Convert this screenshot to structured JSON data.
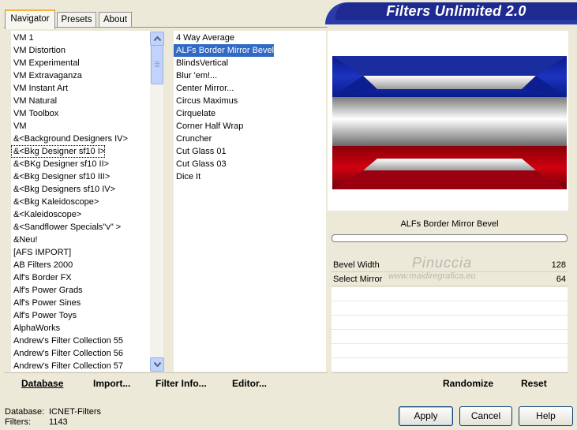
{
  "tabs": [
    "Navigator",
    "Presets",
    "About"
  ],
  "title": "Filters Unlimited 2.0",
  "categories": [
    "VM 1",
    "VM Distortion",
    "VM Experimental",
    "VM Extravaganza",
    "VM Instant Art",
    "VM Natural",
    "VM Toolbox",
    "VM",
    "&<Background Designers IV>",
    "&<Bkg Designer sf10 I>",
    "&<BKg Designer sf10 II>",
    "&<Bkg Designer sf10 III>",
    "&<Bkg Designers sf10 IV>",
    "&<Bkg Kaleidoscope>",
    "&<Kaleidoscope>",
    "&<Sandflower Specials\"v\" >",
    "&Neu!",
    "[AFS IMPORT]",
    "AB Filters 2000",
    "Alf's Border FX",
    "Alf's Power Grads",
    "Alf's Power Sines",
    "Alf's Power Toys",
    "AlphaWorks",
    "Andrew's Filter Collection 55",
    "Andrew's Filter Collection 56",
    "Andrew's Filter Collection 57"
  ],
  "filters": [
    "4 Way Average",
    "ALFs Border Mirror Bevel",
    "BlindsVertical",
    "Blur 'em!...",
    "Center Mirror...",
    "Circus Maximus",
    "Cirquelate",
    "Corner Half Wrap",
    "Cruncher",
    "Cut Glass 01",
    "Cut Glass 03",
    "Dice It"
  ],
  "selected_filter": "ALFs Border Mirror Bevel",
  "params": [
    {
      "label": "Bevel Width",
      "value": "128"
    },
    {
      "label": "Select Mirror",
      "value": "64"
    }
  ],
  "watermark": {
    "name": "Pinuccia",
    "url": "www.maidiregrafica.eu"
  },
  "toolbar": {
    "database": "Database",
    "import": "Import...",
    "filter_info": "Filter Info...",
    "editor": "Editor...",
    "randomize": "Randomize",
    "reset": "Reset"
  },
  "info": {
    "database_label": "Database:",
    "database_value": "ICNET-Filters",
    "filters_label": "Filters:",
    "filters_value": "1143"
  },
  "buttons": {
    "apply": "Apply",
    "cancel": "Cancel",
    "help": "Help"
  },
  "colors": {
    "selection": "#316ac5",
    "banner": "#1e2a8f"
  }
}
